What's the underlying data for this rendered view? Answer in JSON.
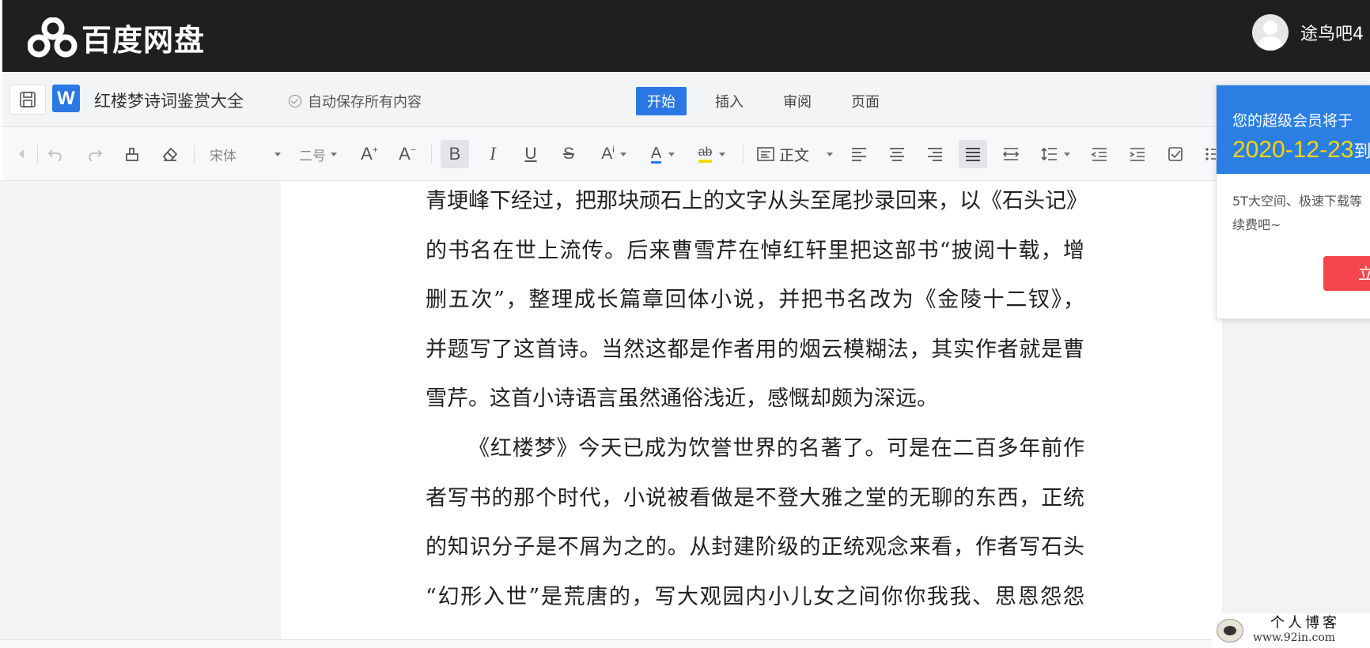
{
  "header": {
    "logo_text": "百度网盘",
    "username": "途鸟吧4"
  },
  "titlebar": {
    "doc_title": "红楼梦诗词鉴赏大全",
    "autosave_text": "自动保存所有内容",
    "tabs": [
      {
        "label": "开始",
        "active": true
      },
      {
        "label": "插入",
        "active": false
      },
      {
        "label": "审阅",
        "active": false
      },
      {
        "label": "页面",
        "active": false
      }
    ]
  },
  "toolbar": {
    "font_family": "宋体",
    "font_size": "二号",
    "paragraph_style": "正文",
    "bold_active": true,
    "justify_active": true,
    "icons": [
      "collapse-icon",
      "undo-icon",
      "redo-icon",
      "format-painter-icon",
      "eraser-icon",
      "increase-font-icon",
      "decrease-font-icon",
      "bold-icon",
      "italic-icon",
      "underline-icon",
      "strikethrough-icon",
      "superscript-icon",
      "font-color-icon",
      "highlight-icon",
      "paragraph-style-icon",
      "align-left-icon",
      "align-center-icon",
      "align-right-icon",
      "align-justify-icon",
      "letter-spacing-icon",
      "line-spacing-icon",
      "outdent-icon",
      "indent-icon",
      "checklist-icon",
      "list-icon"
    ],
    "font_color": "#2b78e4",
    "highlight_color": "#f0e000"
  },
  "document": {
    "paragraphs": [
      {
        "indent": false,
        "lines": [
          "青埂峰下经过，把那块顽石上的文字从头至尾抄录回来，以《石头记》",
          "的书名在世上流传。后来曹雪芹在悼红轩里把这部书“披阅十载，增",
          "删五次”，整理成长篇章回体小说，并把书名改为《金陵十二钗》，",
          "并题写了这首诗。当然这都是作者用的烟云模糊法，其实作者就是曹",
          "雪芹。这首小诗语言虽然通俗浅近，感慨却颇为深远。"
        ]
      },
      {
        "indent": true,
        "lines": [
          "《红楼梦》今天已成为饮誉世界的名著了。可是在二百多年前作",
          "者写书的那个时代，小说被看做是不登大雅之堂的无聊的东西，正统",
          "的知识分子是不屑为之的。从封建阶级的正统观念来看，作者写石头",
          "“幻形入世”是荒唐的，写大观园内小儿女之间你你我我、思恩怨怨"
        ]
      }
    ]
  },
  "popup": {
    "title": "您的超级会员将于",
    "date": "2020-12-23",
    "date_suffix": "到",
    "body_line1": "5T大空间、极速下载等",
    "body_line2": "续费吧~",
    "button_label": "立",
    "accent_color": "#2b7fe3",
    "button_color": "#f5464e"
  },
  "watermark": {
    "title": "个人博客",
    "url": "www.92in.com"
  }
}
